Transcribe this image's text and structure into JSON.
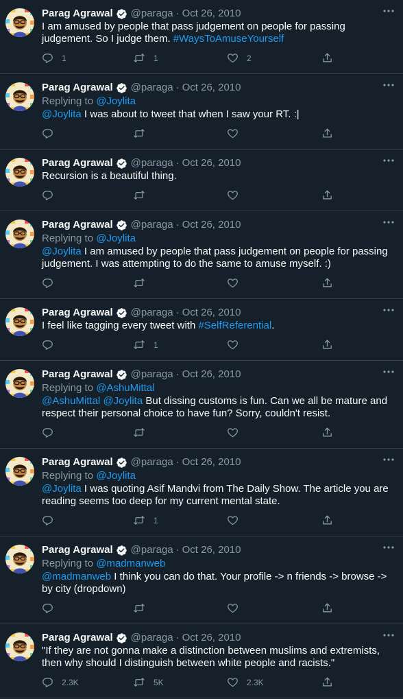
{
  "author": {
    "name": "Parag Agrawal",
    "handle": "@paraga",
    "dot": "·"
  },
  "replying_prefix": "Replying to ",
  "tweets": [
    {
      "date": "Oct 26, 2010",
      "replying_to": null,
      "text": [
        {
          "t": "I am amused by people that pass judgement on people for passing judgement. So I judge them. "
        },
        {
          "t": "#WaysToAmuseYourself",
          "link": true
        }
      ],
      "replies": "1",
      "retweets": "1",
      "likes": "2"
    },
    {
      "date": "Oct 26, 2010",
      "replying_to": "@Joylita",
      "text": [
        {
          "t": "@Joylita",
          "link": true
        },
        {
          "t": " I was about to tweet that when I saw your RT. :|"
        }
      ],
      "replies": "",
      "retweets": "",
      "likes": ""
    },
    {
      "date": "Oct 26, 2010",
      "replying_to": null,
      "text": [
        {
          "t": "Recursion is a beautiful thing."
        }
      ],
      "replies": "",
      "retweets": "",
      "likes": ""
    },
    {
      "date": "Oct 26, 2010",
      "replying_to": "@Joylita",
      "text": [
        {
          "t": "@Joylita",
          "link": true
        },
        {
          "t": " I am amused by people that pass judgement on people for passing judgement. I was attempting to do the same to amuse myself. :)"
        }
      ],
      "replies": "",
      "retweets": "",
      "likes": ""
    },
    {
      "date": "Oct 26, 2010",
      "replying_to": null,
      "text": [
        {
          "t": "I feel like tagging every tweet with "
        },
        {
          "t": "#SelfReferential",
          "link": true
        },
        {
          "t": "."
        }
      ],
      "replies": "",
      "retweets": "1",
      "likes": ""
    },
    {
      "date": "Oct 26, 2010",
      "replying_to": "@AshuMittal",
      "text": [
        {
          "t": "@AshuMittal",
          "link": true
        },
        {
          "t": " "
        },
        {
          "t": "@Joylita",
          "link": true
        },
        {
          "t": " But dissing customs is fun. Can we all be mature and respect their personal choice to have fun? Sorry, couldn't resist."
        }
      ],
      "replies": "",
      "retweets": "",
      "likes": ""
    },
    {
      "date": "Oct 26, 2010",
      "replying_to": "@Joylita",
      "text": [
        {
          "t": "@Joylita",
          "link": true
        },
        {
          "t": " I was quoting Asif Mandvi from The Daily Show. The article you are reading seems too deep for my current mental state."
        }
      ],
      "replies": "",
      "retweets": "1",
      "likes": ""
    },
    {
      "date": "Oct 26, 2010",
      "replying_to": "@madmanweb",
      "text": [
        {
          "t": "@madmanweb",
          "link": true
        },
        {
          "t": " I think you can do that. Your profile -> n friends -> browse -> by city (dropdown)"
        }
      ],
      "replies": "",
      "retweets": "",
      "likes": ""
    },
    {
      "date": "Oct 26, 2010",
      "replying_to": null,
      "text": [
        {
          "t": "\"If they are not gonna make a distinction between muslims and extremists, then why should I distinguish between white people and racists.\""
        }
      ],
      "replies": "2.3K",
      "retweets": "5K",
      "likes": "2.3K"
    }
  ],
  "icons": {
    "avatar": "avatar-icon",
    "verified": "verified-badge-icon",
    "more": "more-options-icon",
    "reply": "reply-icon",
    "retweet": "retweet-icon",
    "like": "like-heart-icon",
    "share": "share-icon"
  },
  "colors": {
    "background": "#15202b",
    "border": "#38444d",
    "link": "#1d9bf0",
    "muted": "#8b98a5",
    "text": "#f7f9f9"
  }
}
